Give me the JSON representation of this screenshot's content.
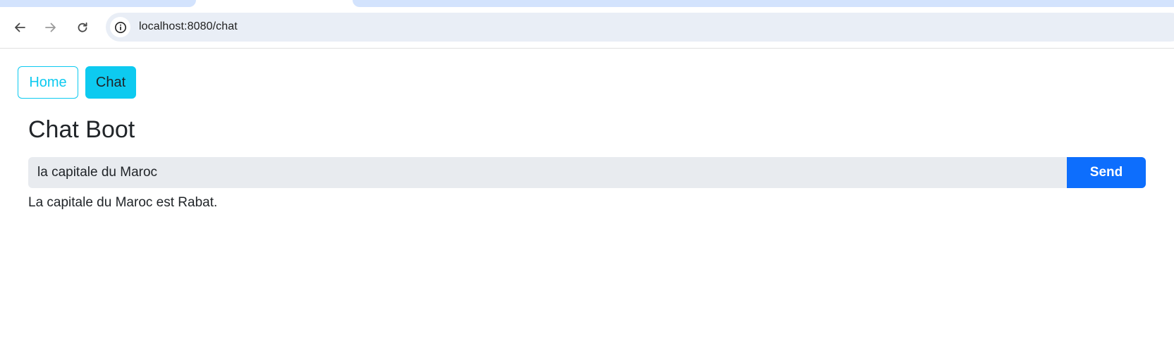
{
  "browser": {
    "url": "localhost:8080/chat",
    "icons": {
      "back": "arrow-left-icon",
      "forward": "arrow-right-icon",
      "reload": "reload-icon",
      "site_info": "info-circle-icon"
    }
  },
  "nav": {
    "home_label": "Home",
    "chat_label": "Chat",
    "active": "Chat"
  },
  "main": {
    "title": "Chat Boot",
    "input_value": "la capitale du Maroc",
    "send_label": "Send",
    "response": "La capitale du Maroc est Rabat."
  },
  "colors": {
    "info_accent": "#0dcaf0",
    "primary_button": "#0d6efd",
    "input_background": "#e8ebef",
    "omnibox_background": "#e9eef6",
    "tab_background": "#d3e3fd"
  }
}
